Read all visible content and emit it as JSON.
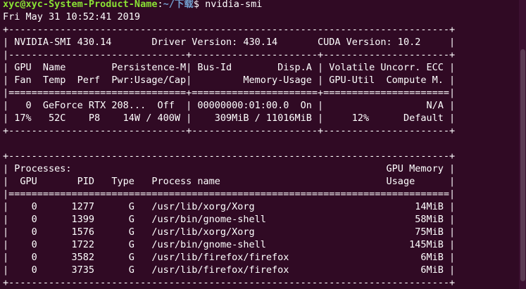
{
  "prompt": {
    "user_host": "xyc@xyc-System-Product-Name",
    "separator": ":",
    "path": "~/下载",
    "symbol": "$ ",
    "command": "nvidia-smi"
  },
  "output_lines": [
    "Fri May 31 10:52:41 2019",
    "+-----------------------------------------------------------------------------+",
    "| NVIDIA-SMI 430.14       Driver Version: 430.14       CUDA Version: 10.2     |",
    "|-------------------------------+----------------------+----------------------+",
    "| GPU  Name        Persistence-M| Bus-Id        Disp.A | Volatile Uncorr. ECC |",
    "| Fan  Temp  Perf  Pwr:Usage/Cap|         Memory-Usage | GPU-Util  Compute M. |",
    "|===============================+======================+======================|",
    "|   0  GeForce RTX 208...  Off  | 00000000:01:00.0  On |                  N/A |",
    "| 17%   52C    P8    14W / 400W |    309MiB / 11016MiB |     12%      Default |",
    "+-------------------------------+----------------------+----------------------+",
    "",
    "+-----------------------------------------------------------------------------+",
    "| Processes:                                                       GPU Memory |",
    "|  GPU       PID   Type   Process name                             Usage      |",
    "|=============================================================================|",
    "|    0      1277      G   /usr/lib/xorg/Xorg                            14MiB |",
    "|    0      1399      G   /usr/bin/gnome-shell                          58MiB |",
    "|    0      1576      G   /usr/lib/xorg/Xorg                            75MiB |",
    "|    0      1722      G   /usr/bin/gnome-shell                         145MiB |",
    "|    0      3582      G   /usr/lib/firefox/firefox                       6MiB |",
    "|    0      3735      G   /usr/lib/firefox/firefox                       6MiB |",
    "+-----------------------------------------------------------------------------+"
  ]
}
